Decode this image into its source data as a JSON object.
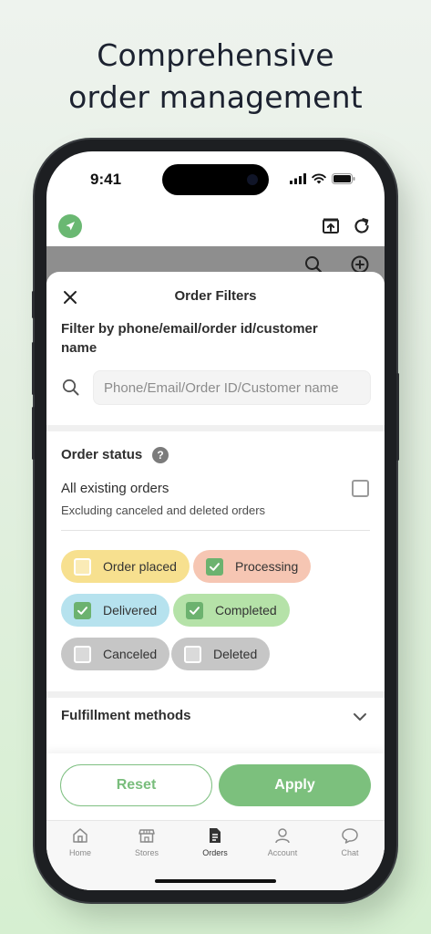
{
  "headline": {
    "line1": "Comprehensive",
    "line2": "order management"
  },
  "status_bar": {
    "time": "9:41"
  },
  "sheet": {
    "title": "Order Filters",
    "filter_label": "Filter by phone/email/order id/customer name",
    "search_placeholder": "Phone/Email/Order ID/Customer name",
    "order_status_label": "Order status",
    "help_glyph": "?",
    "all_orders_title": "All existing orders",
    "all_orders_subtitle": "Excluding canceled and deleted orders",
    "all_orders_checked": false,
    "statuses": [
      {
        "label": "Order placed",
        "checked": false,
        "color": "#f7e08f"
      },
      {
        "label": "Processing",
        "checked": true,
        "color": "#f6c6b3"
      },
      {
        "label": "Delivered",
        "checked": true,
        "color": "#b6e2ee"
      },
      {
        "label": "Completed",
        "checked": true,
        "color": "#b5e2a8"
      },
      {
        "label": "Canceled",
        "checked": false,
        "color": "#c6c6c6"
      },
      {
        "label": "Deleted",
        "checked": false,
        "color": "#c6c6c6"
      }
    ],
    "fulfillment_label": "Fulfillment methods",
    "reset_label": "Reset",
    "apply_label": "Apply"
  },
  "tabbar": {
    "items": [
      {
        "label": "Home",
        "icon": "home-icon",
        "active": false
      },
      {
        "label": "Stores",
        "icon": "store-icon",
        "active": false
      },
      {
        "label": "Orders",
        "icon": "orders-icon",
        "active": true
      },
      {
        "label": "Account",
        "icon": "account-icon",
        "active": false
      },
      {
        "label": "Chat",
        "icon": "chat-icon",
        "active": false
      }
    ]
  },
  "colors": {
    "accent": "#7cc07d",
    "logo": "#6ab872"
  }
}
